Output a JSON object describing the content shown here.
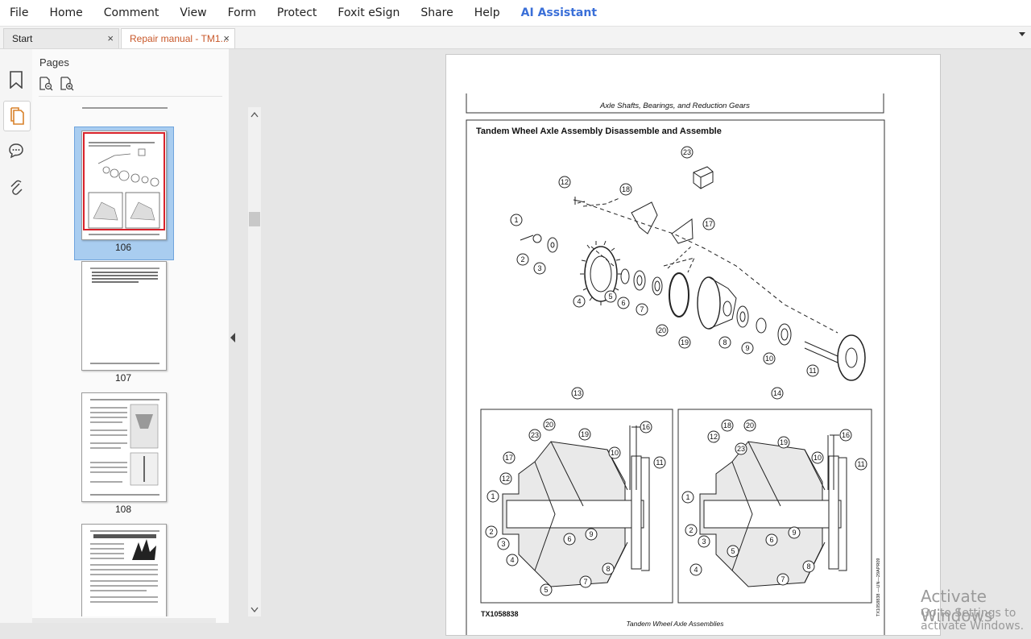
{
  "menu": [
    "File",
    "Home",
    "Comment",
    "View",
    "Form",
    "Protect",
    "Foxit eSign",
    "Share",
    "Help"
  ],
  "ai_assistant": "AI Assistant",
  "tabs": {
    "start": "Start",
    "active": "Repair manual - TM1...",
    "close": "×"
  },
  "pages_panel": {
    "title": "Pages",
    "thumb_labels": [
      "106",
      "107",
      "108"
    ]
  },
  "document": {
    "header": "Axle Shafts, Bearings, and Reduction Gears",
    "title": "Tandem Wheel Axle Assembly Disassemble and Assemble",
    "figure_id": "TX1058838",
    "side_code": "TX1058838 —UN—29APR09",
    "caption": "Tandem Wheel Axle Assemblies",
    "callouts": {
      "c1": "1",
      "c2": "2",
      "c3": "3",
      "c4": "4",
      "c5": "5",
      "c6": "6",
      "c7": "7",
      "c8": "8",
      "c9": "9",
      "c10": "10",
      "c11": "11",
      "c12": "12",
      "c13": "13",
      "c14": "14",
      "c16": "16",
      "c17": "17",
      "c18": "18",
      "c19": "19",
      "c20": "20",
      "c23": "23"
    }
  },
  "watermark": {
    "line1": "Activate Windows",
    "line2": "Go to Settings to activate Windows."
  }
}
